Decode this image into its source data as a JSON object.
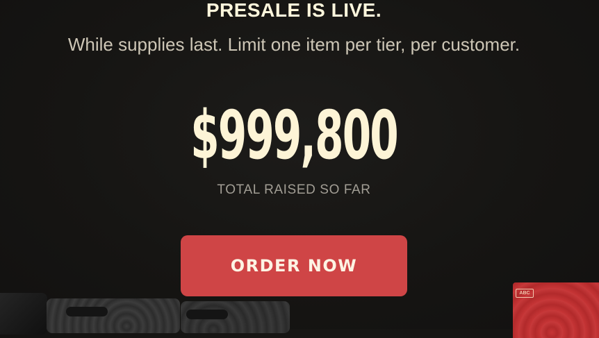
{
  "hero": {
    "headline": "PRESALE IS LIVE.",
    "subline": "While supplies last. Limit one item per tier, per customer."
  },
  "stats": {
    "total_raised": "$999,800",
    "total_raised_label": "TOTAL RAISED SO FAR"
  },
  "cta": {
    "order_label": "ORDER NOW"
  },
  "products": {
    "red_box_label": "ABC"
  },
  "colors": {
    "background": "#161513",
    "headline": "#fdf6dc",
    "button": "#cf4546",
    "button_text": "#fdf4e4"
  }
}
